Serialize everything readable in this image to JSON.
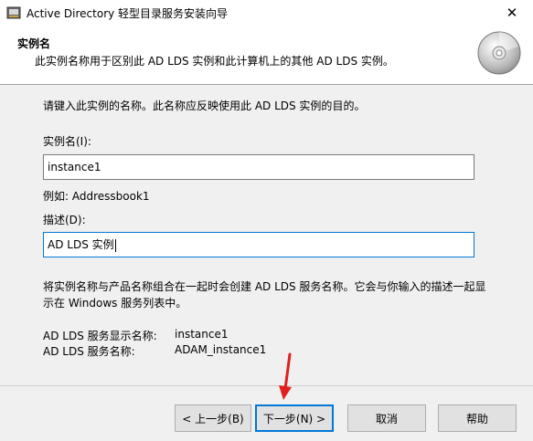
{
  "window": {
    "title": "Active Directory 轻型目录服务安装向导",
    "close_glyph": "✕"
  },
  "header": {
    "title": "实例名",
    "subtitle": "此实例名称用于区别此 AD LDS 实例和此计算机上的其他 AD LDS 实例。"
  },
  "content": {
    "intro": "请键入此实例的名称。此名称应反映使用此 AD LDS 实例的目的。",
    "instance_name_label": "实例名(I):",
    "instance_name_value": "instance1",
    "example_text": "例如: Addressbook1",
    "description_label": "描述(D):",
    "description_value": "AD LDS 实例",
    "note": "将实例名称与产品名称组合在一起时会创建 AD LDS 服务名称。它会与你输入的描述一起显示在 Windows 服务列表中。",
    "display_name_label": "AD LDS 服务显示名称:",
    "display_name_value": "instance1",
    "service_name_label": "AD LDS 服务名称:",
    "service_name_value": "ADAM_instance1"
  },
  "buttons": {
    "back": "< 上一步(B)",
    "next": "下一步(N) >",
    "cancel": "取消",
    "help": "帮助"
  },
  "icons": {
    "app": "wizard-app-icon",
    "header": "cd-disc-icon",
    "annotation": "red-arrow-icon"
  },
  "colors": {
    "focus_border": "#0078d7",
    "annotation_arrow": "#e02020"
  }
}
